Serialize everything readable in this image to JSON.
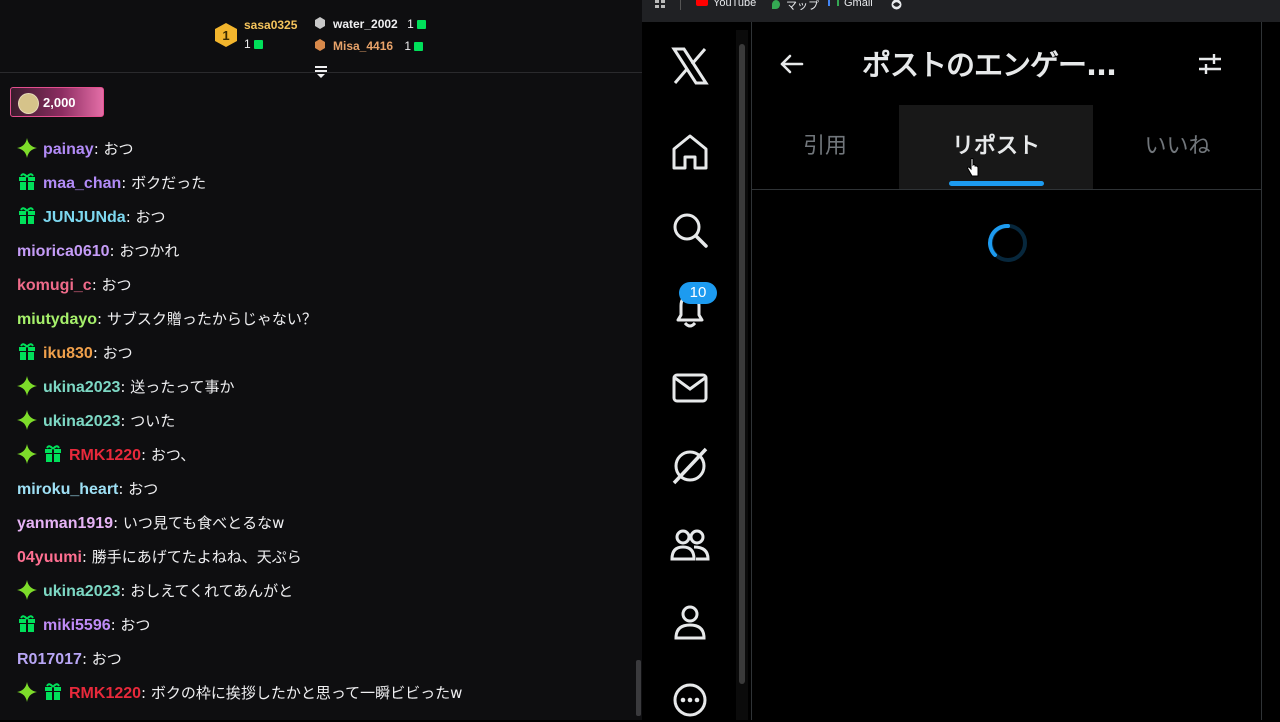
{
  "chat": {
    "leaderboard": [
      {
        "rank": "1",
        "name": "sasa0325",
        "count": "1",
        "name_color": "#f5c45c"
      },
      {
        "rank": "2",
        "name": "water_2002",
        "count": "1",
        "name_color": "#efeff1"
      },
      {
        "rank": "3",
        "name": "Misa_4416",
        "count": "1",
        "name_color": "#e8a36a"
      }
    ],
    "cheer": {
      "amount": "2,000"
    },
    "messages": [
      {
        "user": "painay",
        "text": ": おつ",
        "color": "#b28bf7",
        "badges": [
          "sparkle-icon"
        ]
      },
      {
        "user": "maa_chan",
        "text": ": ボクだった",
        "color": "#b28bf7",
        "badges": [
          "gift-icon"
        ]
      },
      {
        "user": "JUNJUNda",
        "text": ": おつ",
        "color": "#7dd8f0",
        "badges": [
          "gift-icon"
        ]
      },
      {
        "user": "miorica0610",
        "text": ": おつかれ",
        "color": "#c59cf7",
        "badges": []
      },
      {
        "user": "komugi_c",
        "text": ": おつ",
        "color": "#ef6b8a",
        "badges": []
      },
      {
        "user": "miutydayo",
        "text": ": サブスク贈ったからじゃない？",
        "color": "#a6f06b",
        "badges": []
      },
      {
        "user": "iku830",
        "text": ": おつ",
        "color": "#f0a04b",
        "badges": [
          "gift-icon"
        ]
      },
      {
        "user": "ukina2023",
        "text": ": 送ったって事か",
        "color": "#7dd8c4",
        "badges": [
          "sparkle-icon"
        ]
      },
      {
        "user": "ukina2023",
        "text": ": ついた",
        "color": "#7dd8c4",
        "badges": [
          "sparkle-icon"
        ]
      },
      {
        "user": "RMK1220",
        "text": ": おつ、",
        "color": "#e8293b",
        "badges": [
          "sparkle-icon",
          "gift-icon"
        ]
      },
      {
        "user": "miroku_heart",
        "text": ": おつ",
        "color": "#9ee0f5",
        "badges": []
      },
      {
        "user": "yanman1919",
        "text": ": いつ見ても食べとるなw",
        "color": "#e6b3f5",
        "badges": []
      },
      {
        "user": "04yuumi",
        "text": ": 勝手にあげてたよねね、天ぷら",
        "color": "#ff6f91",
        "badges": []
      },
      {
        "user": "ukina2023",
        "text": ": おしえてくれてあんがと",
        "color": "#7dd8c4",
        "badges": [
          "sparkle-icon"
        ]
      },
      {
        "user": "miki5596",
        "text": ": おつ",
        "color": "#c08cf7",
        "badges": [
          "gift-icon"
        ]
      },
      {
        "user": "R017017",
        "text": ": おつ",
        "color": "#b8a6f5",
        "badges": []
      },
      {
        "user": "RMK1220",
        "text": ": ボクの枠に挨拶したかと思って一瞬ビビったw",
        "color": "#e8293b",
        "badges": [
          "sparkle-icon",
          "gift-icon"
        ]
      }
    ]
  },
  "browser": {
    "bookmarks": [
      {
        "label": "YouTube",
        "icon": "youtube-icon"
      },
      {
        "label": "マップ",
        "icon": "maps-icon"
      },
      {
        "label": "Gmail",
        "icon": "gmail-icon"
      }
    ],
    "x": {
      "title": "ポストのエンゲー...",
      "notification_count": "10",
      "tabs": [
        "引用",
        "リポスト",
        "いいね"
      ],
      "active_tab": "リポスト",
      "accent": "#1d9bf0",
      "nav_icons": [
        "x-logo-icon",
        "home-icon",
        "search-icon",
        "bell-icon",
        "mail-icon",
        "grok-icon",
        "communities-icon",
        "profile-icon",
        "more-icon"
      ]
    }
  }
}
